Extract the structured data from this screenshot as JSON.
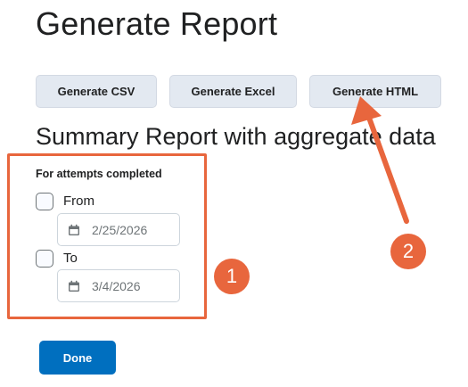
{
  "page_title": "Generate Report",
  "buttons": {
    "csv": "Generate CSV",
    "excel": "Generate Excel",
    "html": "Generate HTML",
    "done": "Done"
  },
  "section_title": "Summary Report with aggregate data",
  "filter": {
    "group_label": "For attempts completed",
    "from": {
      "label": "From",
      "checked": false,
      "date": "2/25/2026"
    },
    "to": {
      "label": "To",
      "checked": false,
      "date": "3/4/2026"
    }
  },
  "annotations": {
    "callout_1": "1",
    "callout_2": "2",
    "color": "#e8663d"
  },
  "icons": {
    "date_icon": "calendar-icon"
  },
  "colors": {
    "primary": "#006fbf",
    "secondary_button": "#e3e9f1"
  }
}
